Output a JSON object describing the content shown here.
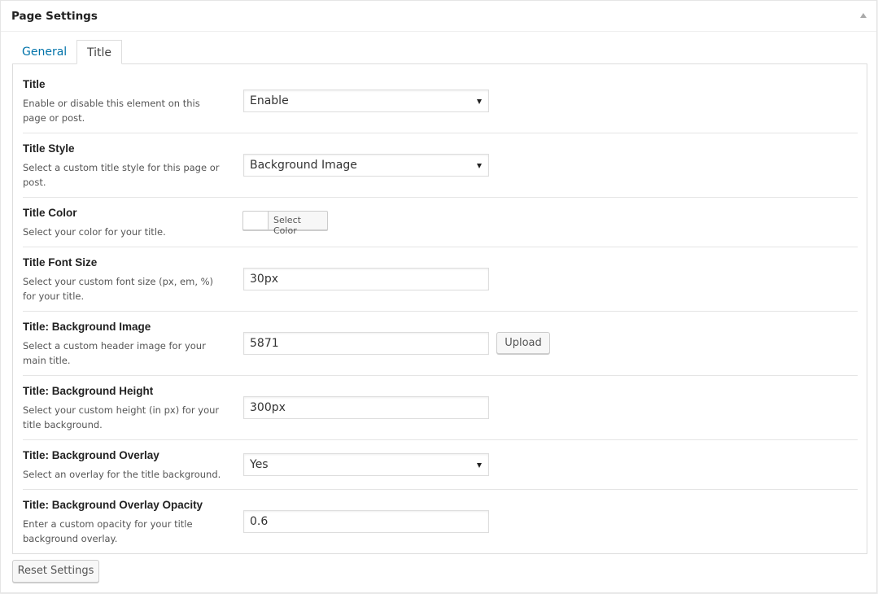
{
  "box": {
    "title": "Page Settings"
  },
  "tabs": [
    {
      "label": "General",
      "active": false
    },
    {
      "label": "Title",
      "active": true
    }
  ],
  "settings": {
    "title": {
      "label": "Title",
      "desc": "Enable or disable this element on this page or post.",
      "value": "Enable"
    },
    "title_style": {
      "label": "Title Style",
      "desc": "Select a custom title style for this page or post.",
      "value": "Background Image"
    },
    "title_color": {
      "label": "Title Color",
      "desc": "Select your color for your title.",
      "button": "Select Color"
    },
    "title_font_size": {
      "label": "Title Font Size",
      "desc": "Select your custom font size (px, em, %) for your title.",
      "value": "30px"
    },
    "bg_image": {
      "label": "Title: Background Image",
      "desc": "Select a custom header image for your main title.",
      "value": "5871",
      "button": "Upload"
    },
    "bg_height": {
      "label": "Title: Background Height",
      "desc": "Select your custom height (in px) for your title background.",
      "value": "300px"
    },
    "bg_overlay": {
      "label": "Title: Background Overlay",
      "desc": "Select an overlay for the title background.",
      "value": "Yes"
    },
    "bg_overlay_opacity": {
      "label": "Title: Background Overlay Opacity",
      "desc": "Enter a custom opacity for your title background overlay.",
      "value": "0.6"
    }
  },
  "footer": {
    "reset_label": "Reset Settings"
  },
  "colors": {
    "link": "#0073aa",
    "border": "#dddddd"
  }
}
